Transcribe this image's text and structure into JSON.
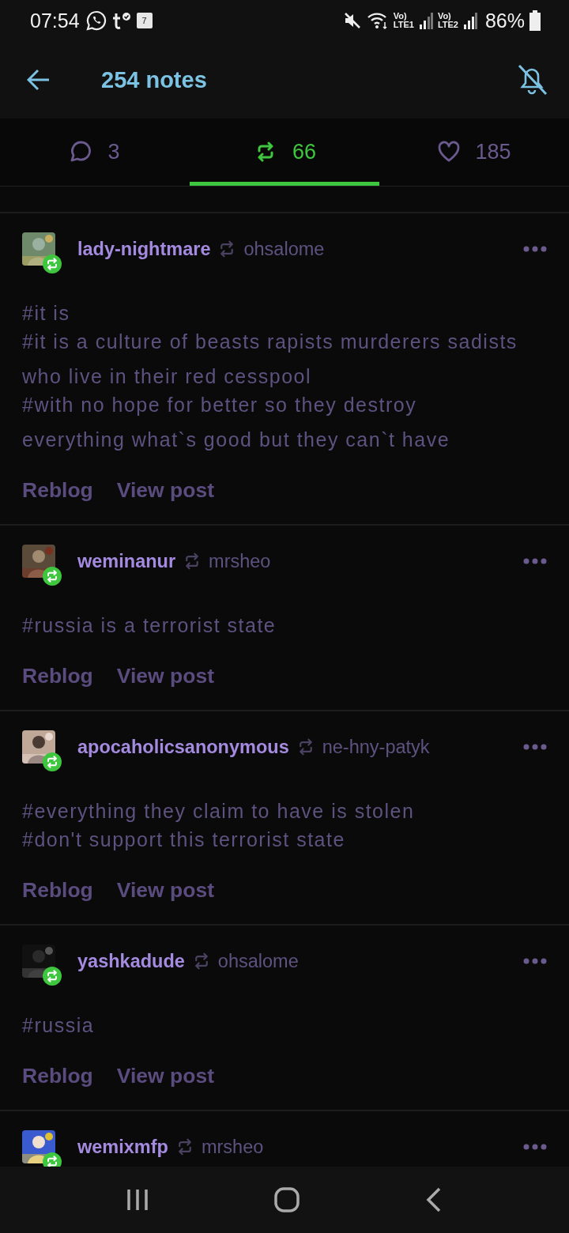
{
  "status_bar": {
    "time": "07:54",
    "calendar_day": "7",
    "sim1_label": "Vo)",
    "sim1_network": "LTE1",
    "sim2_label": "Vo)",
    "sim2_network": "LTE2",
    "battery": "86%"
  },
  "header": {
    "title": "254 notes"
  },
  "tabs": [
    {
      "kind": "replies",
      "count": "3",
      "selected": false
    },
    {
      "kind": "reblogs",
      "count": "66",
      "selected": true
    },
    {
      "kind": "likes",
      "count": "185",
      "selected": false
    }
  ],
  "notes": [
    {
      "user": "lady-nightmare",
      "source": "ohsalome",
      "tags": [
        "#it is",
        "#it is a culture of beasts rapists murderers sadists who live in their red cesspool",
        "#with no hope for better so they destroy everything what`s good but they can`t have"
      ],
      "actions": [
        "Reblog",
        "View post"
      ]
    },
    {
      "user": "weminanur",
      "source": "mrsheo",
      "tags": [
        "#russia is a terrorist state"
      ],
      "actions": [
        "Reblog",
        "View post"
      ]
    },
    {
      "user": "apocaholicsanonymous",
      "source": "ne-hny-patyk",
      "tags": [
        "#everything they claim to have is stolen",
        "#don't support this terrorist state"
      ],
      "actions": [
        "Reblog",
        "View post"
      ]
    },
    {
      "user": "yashkadude",
      "source": "ohsalome",
      "tags": [
        "#russia"
      ],
      "actions": [
        "Reblog",
        "View post"
      ]
    },
    {
      "user": "wemixmfp",
      "source": "mrsheo"
    }
  ]
}
